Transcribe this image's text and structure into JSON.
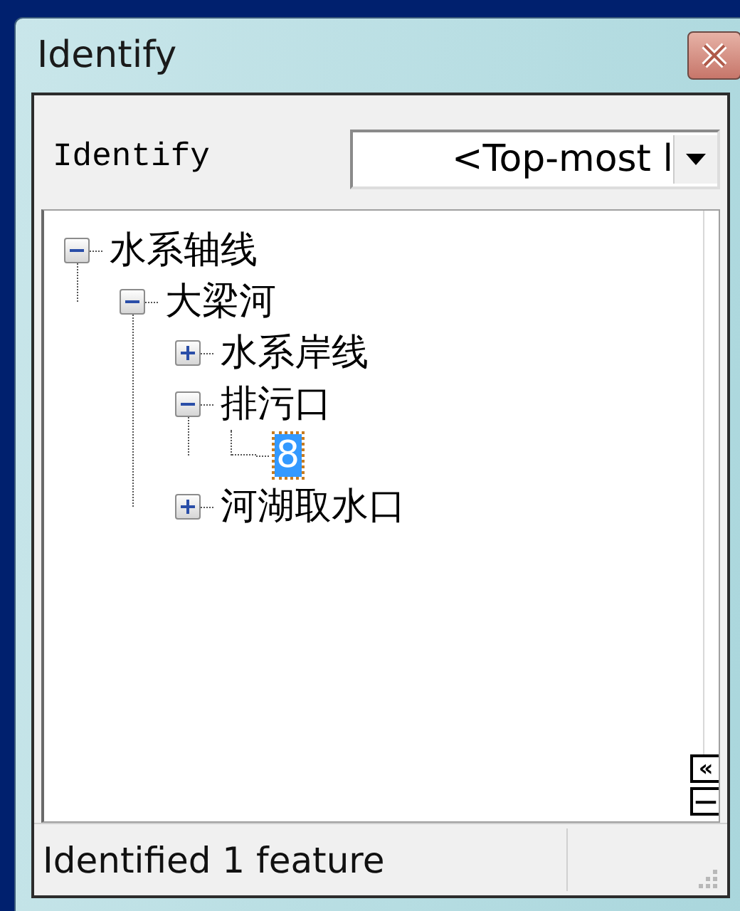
{
  "window": {
    "title": "Identify"
  },
  "identify_from": {
    "label": "Identify",
    "value": "<Top-most l"
  },
  "tree": [
    {
      "label": "水系轴线",
      "expanded": true,
      "selected": false,
      "children": [
        {
          "label": "大梁河",
          "expanded": true,
          "selected": false,
          "children": [
            {
              "label": "水系岸线",
              "expanded": false,
              "selected": false
            },
            {
              "label": "排污口",
              "expanded": true,
              "selected": false,
              "children": [
                {
                  "label": "8",
                  "selected": true
                }
              ]
            },
            {
              "label": "河湖取水口",
              "expanded": false,
              "selected": false
            }
          ]
        }
      ]
    }
  ],
  "panel_buttons": [
    {
      "label": "«"
    },
    {
      "label": "—"
    }
  ],
  "status_bar": {
    "text": "Identified 1 feature"
  }
}
